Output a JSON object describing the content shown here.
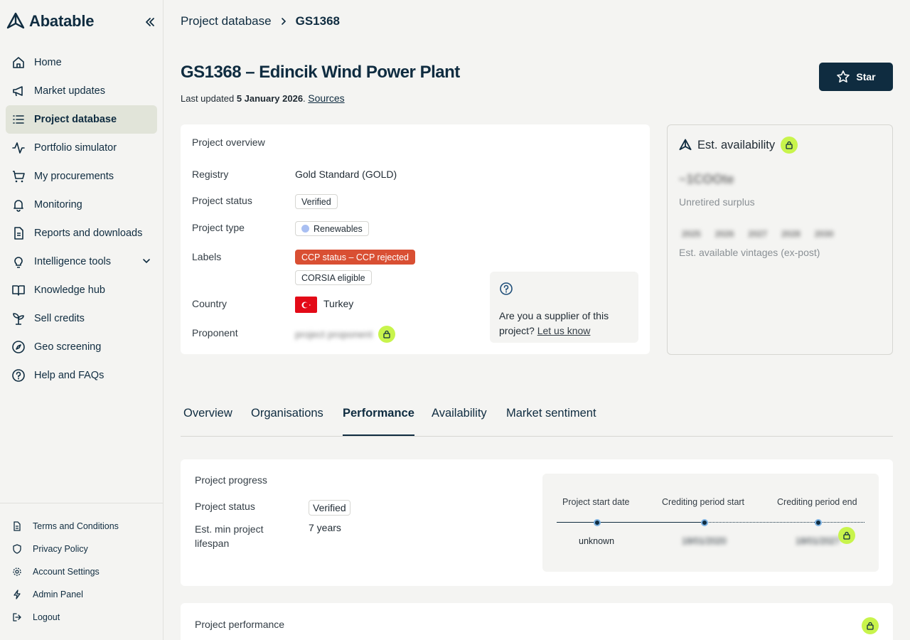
{
  "app": {
    "name": "Abatable"
  },
  "sidebar": {
    "items": [
      {
        "label": "Home",
        "icon": "home-icon"
      },
      {
        "label": "Market updates",
        "icon": "megaphone-icon"
      },
      {
        "label": "Project database",
        "icon": "list-icon",
        "active": true
      },
      {
        "label": "Portfolio simulator",
        "icon": "activity-icon"
      },
      {
        "label": "My procurements",
        "icon": "cart-icon"
      },
      {
        "label": "Monitoring",
        "icon": "bell-icon"
      },
      {
        "label": "Reports and downloads",
        "icon": "document-icon"
      },
      {
        "label": "Intelligence tools",
        "icon": "lightbulb-icon",
        "expandable": true
      },
      {
        "label": "Knowledge hub",
        "icon": "book-icon"
      },
      {
        "label": "Sell credits",
        "icon": "sprout-icon"
      },
      {
        "label": "Geo screening",
        "icon": "compass-icon"
      },
      {
        "label": "Help and FAQs",
        "icon": "help-icon"
      }
    ],
    "footer": [
      {
        "label": "Terms and Conditions",
        "icon": "file-icon"
      },
      {
        "label": "Privacy Policy",
        "icon": "shield-icon"
      },
      {
        "label": "Account Settings",
        "icon": "gear-icon"
      },
      {
        "label": "Admin Panel",
        "icon": "bolt-icon"
      },
      {
        "label": "Logout",
        "icon": "logout-icon"
      }
    ]
  },
  "breadcrumb": {
    "parent": "Project database",
    "current": "GS1368"
  },
  "page": {
    "title": "GS1368 – Edincik Wind Power Plant",
    "updated_prefix": "Last updated",
    "updated_date": "5 January 2026",
    "sources_link": "Sources",
    "star_label": "Star"
  },
  "overview": {
    "title": "Project overview",
    "registry_label": "Registry",
    "registry_value": "Gold Standard (GOLD)",
    "status_label": "Project status",
    "status_value": "Verified",
    "type_label": "Project type",
    "type_value": "Renewables",
    "labels_label": "Labels",
    "label_ccp": "CCP status – CCP rejected",
    "label_corsia": "CORSIA eligible",
    "country_label": "Country",
    "country_value": "Turkey",
    "proponent_label": "Proponent",
    "proponent_value": "project proponent",
    "supplier_text": "Are you a supplier of this project?",
    "supplier_link": "Let us know"
  },
  "availability": {
    "title": "Est. availability",
    "value": "~1COOte",
    "value_label": "Unretired surplus",
    "vintages": [
      "2025",
      "2026",
      "2027",
      "2028",
      "2030"
    ],
    "vintages_label": "Est. available vintages (ex-post)"
  },
  "tabs": [
    "Overview",
    "Organisations",
    "Performance",
    "Availability",
    "Market sentiment"
  ],
  "active_tab": "Performance",
  "progress": {
    "title": "Project progress",
    "status_label": "Project status",
    "status_value": "Verified",
    "lifespan_label": "Est. min project lifespan",
    "lifespan_value": "7 years",
    "timeline": {
      "start_label": "Project start date",
      "start_value": "unknown",
      "credit_start_label": "Crediting period start",
      "credit_start_value": "18/01/2020",
      "credit_end_label": "Crediting period end",
      "credit_end_value": "18/01/2027"
    }
  },
  "performance": {
    "title": "Project performance"
  },
  "colors": {
    "navy": "#0f2c40",
    "lime": "#c8f44c",
    "red": "#d94f33"
  }
}
